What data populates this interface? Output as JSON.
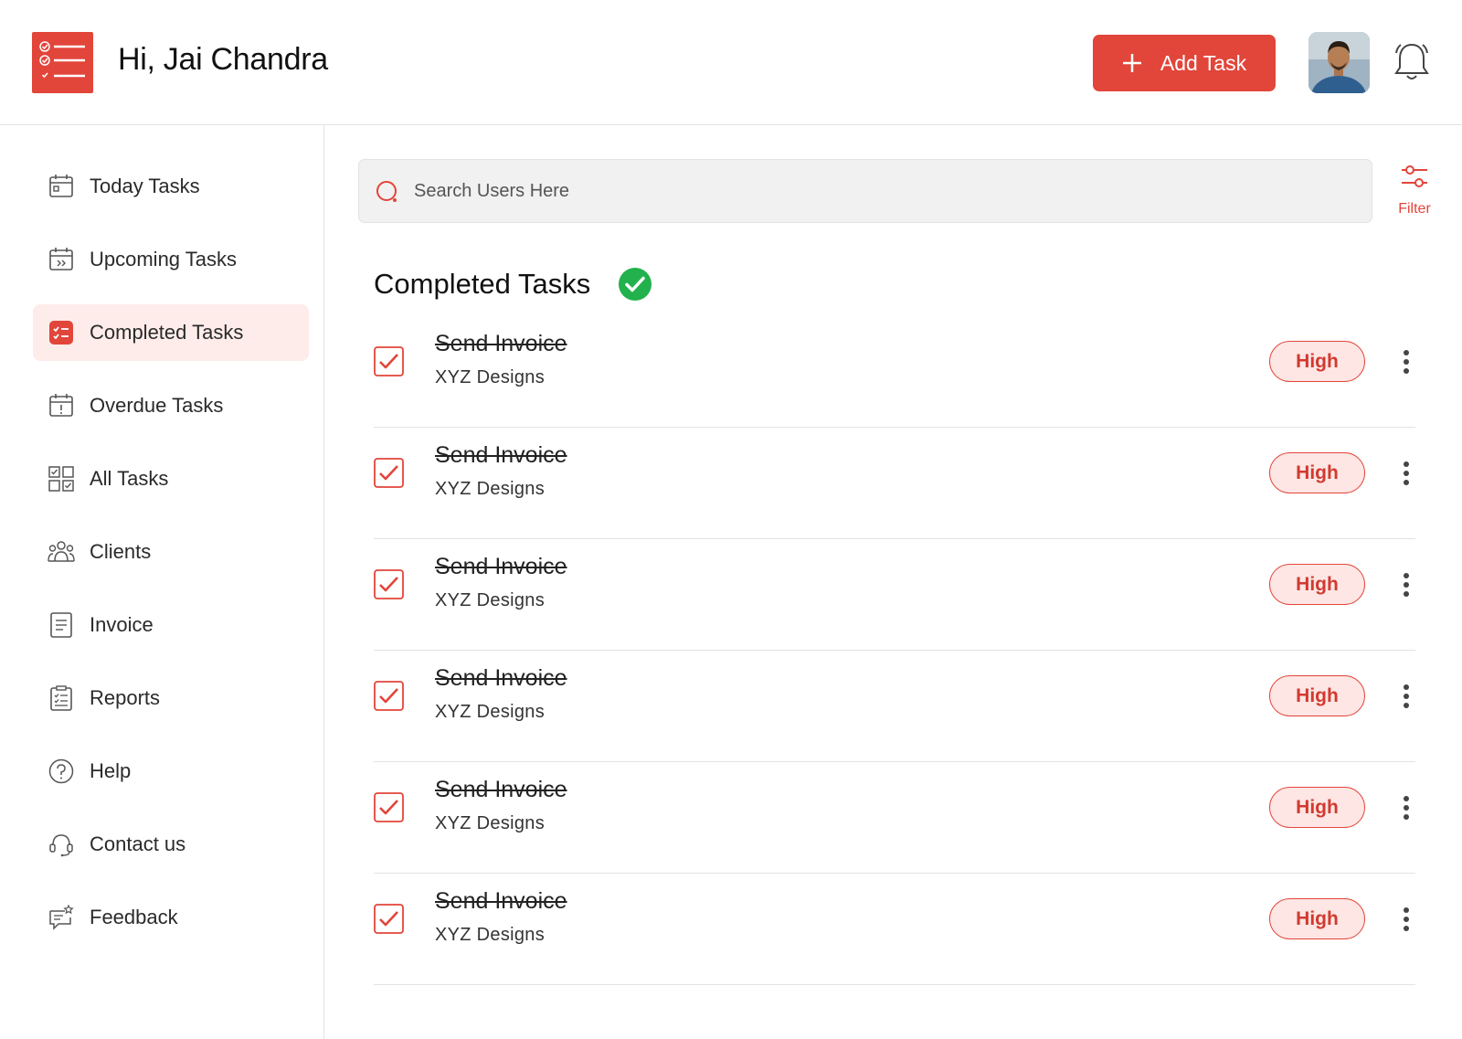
{
  "header": {
    "greeting": "Hi, Jai Chandra",
    "add_task_label": "Add Task"
  },
  "colors": {
    "accent": "#e2453a",
    "accent_soft": "#fdecea",
    "success": "#22b14c"
  },
  "sidebar": {
    "items": [
      {
        "label": "Today Tasks",
        "icon": "calendar-today-icon"
      },
      {
        "label": "Upcoming Tasks",
        "icon": "calendar-upcoming-icon"
      },
      {
        "label": "Completed Tasks",
        "icon": "checklist-icon",
        "active": true
      },
      {
        "label": "Overdue Tasks",
        "icon": "calendar-alert-icon"
      },
      {
        "label": "All Tasks",
        "icon": "grid-check-icon"
      },
      {
        "label": "Clients",
        "icon": "people-icon"
      },
      {
        "label": "Invoice",
        "icon": "document-icon"
      },
      {
        "label": "Reports",
        "icon": "clipboard-icon"
      },
      {
        "label": "Help",
        "icon": "question-circle-icon"
      },
      {
        "label": "Contact us",
        "icon": "headset-icon"
      },
      {
        "label": "Feedback",
        "icon": "chat-star-icon"
      }
    ]
  },
  "search": {
    "placeholder": "Search Users Here"
  },
  "filter": {
    "label": "Filter"
  },
  "main": {
    "section_title": "Completed Tasks",
    "tasks": [
      {
        "title": "Send Invoice",
        "client": "XYZ Designs",
        "priority": "High",
        "completed": true
      },
      {
        "title": "Send Invoice",
        "client": "XYZ Designs",
        "priority": "High",
        "completed": true
      },
      {
        "title": "Send Invoice",
        "client": "XYZ Designs",
        "priority": "High",
        "completed": true
      },
      {
        "title": "Send Invoice",
        "client": "XYZ Designs",
        "priority": "High",
        "completed": true
      },
      {
        "title": "Send Invoice",
        "client": "XYZ Designs",
        "priority": "High",
        "completed": true
      },
      {
        "title": "Send Invoice",
        "client": "XYZ Designs",
        "priority": "High",
        "completed": true
      }
    ]
  }
}
